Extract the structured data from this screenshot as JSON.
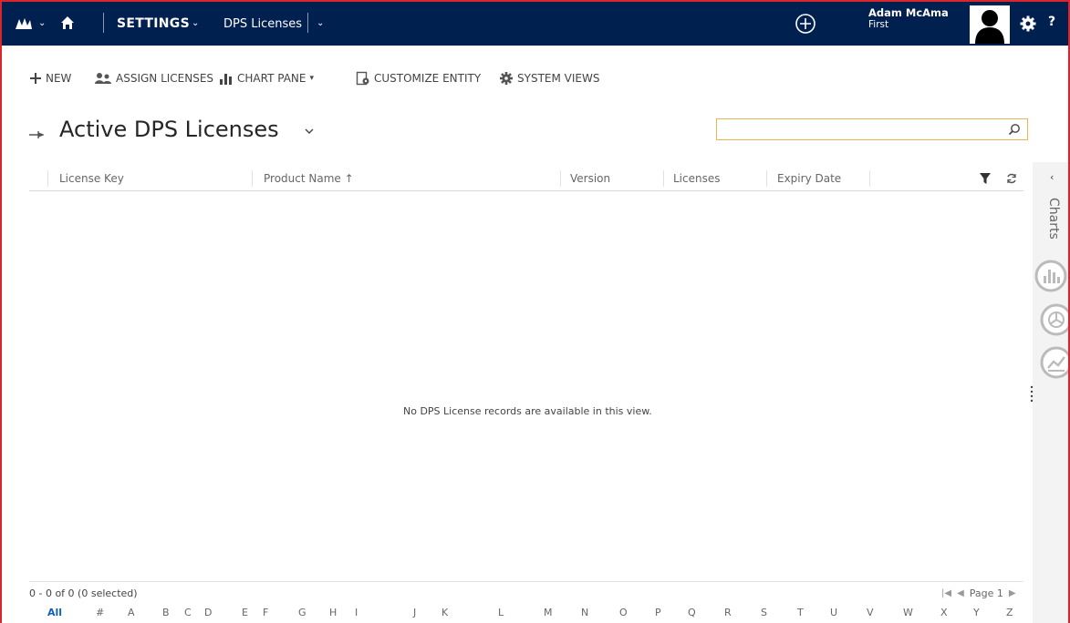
{
  "nav": {
    "module": "SETTINGS",
    "breadcrumb": "DPS Licenses",
    "user_name": "Adam McAma",
    "user_org": "First",
    "help": "?"
  },
  "commands": [
    {
      "label": "NEW",
      "icon": "plus-icon"
    },
    {
      "label": "ASSIGN LICENSES",
      "icon": "users-icon"
    },
    {
      "label": "CHART PANE",
      "icon": "bar-chart-icon"
    },
    {
      "label": "CUSTOMIZE ENTITY",
      "icon": "customize-icon"
    },
    {
      "label": "SYSTEM VIEWS",
      "icon": "gear-icon"
    }
  ],
  "view": {
    "title": "Active DPS Licenses",
    "search_value": ""
  },
  "grid": {
    "columns": [
      "License Key",
      "Product Name ↑",
      "Version",
      "Licenses",
      "Expiry Date"
    ],
    "empty_message": "No DPS License records are available in this view.",
    "count_text": "0 - 0 of 0 (0 selected)",
    "page_text": "Page 1"
  },
  "side_pane": {
    "label": "Charts"
  },
  "alphabet": [
    "All",
    "#",
    "A",
    "B",
    "C",
    "D",
    "E",
    "F",
    "G",
    "H",
    "I",
    "J",
    "K",
    "L",
    "M",
    "N",
    "O",
    "P",
    "Q",
    "R",
    "S",
    "T",
    "U",
    "V",
    "W",
    "X",
    "Y",
    "Z"
  ],
  "colors": {
    "nav_bg": "#002050",
    "accent": "#1160b7",
    "search_border": "#e8b650",
    "frame_border": "#d9262d"
  }
}
